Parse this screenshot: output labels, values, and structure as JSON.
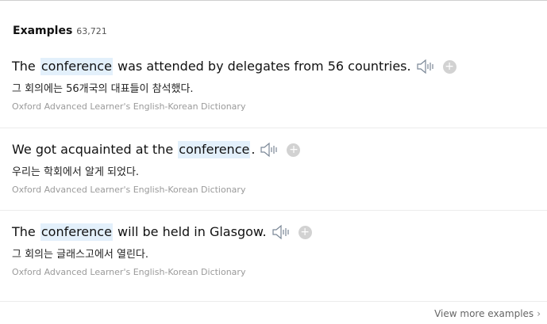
{
  "header": {
    "title": "Examples",
    "count": "63,721"
  },
  "examples": [
    {
      "before": "The",
      "keyword": "conference",
      "after": "was attended by delegates from 56 countries.",
      "translation": "그 회의에는 56개국의 대표들이 참석했다.",
      "source": "Oxford Advanced Learner's English-Korean Dictionary"
    },
    {
      "before": "We got acquainted at the",
      "keyword": "conference",
      "after": ".",
      "translation": "우리는 학회에서 알게 되었다.",
      "source": "Oxford Advanced Learner's English-Korean Dictionary"
    },
    {
      "before": "The",
      "keyword": "conference",
      "after": "will be held in Glasgow.",
      "translation": "그 회의는 글래스고에서 열린다.",
      "source": "Oxford Advanced Learner's English-Korean Dictionary"
    }
  ],
  "icons": {
    "speaker": "speaker-icon",
    "add": "add-icon",
    "chevron": "chevron-right-icon"
  },
  "footer": {
    "view_more_label": "View more examples",
    "chevron": "›"
  },
  "colors": {
    "highlight": "#e3f0fb",
    "source_text": "#9a9a9a",
    "plus_button": "#d2d2d2"
  }
}
